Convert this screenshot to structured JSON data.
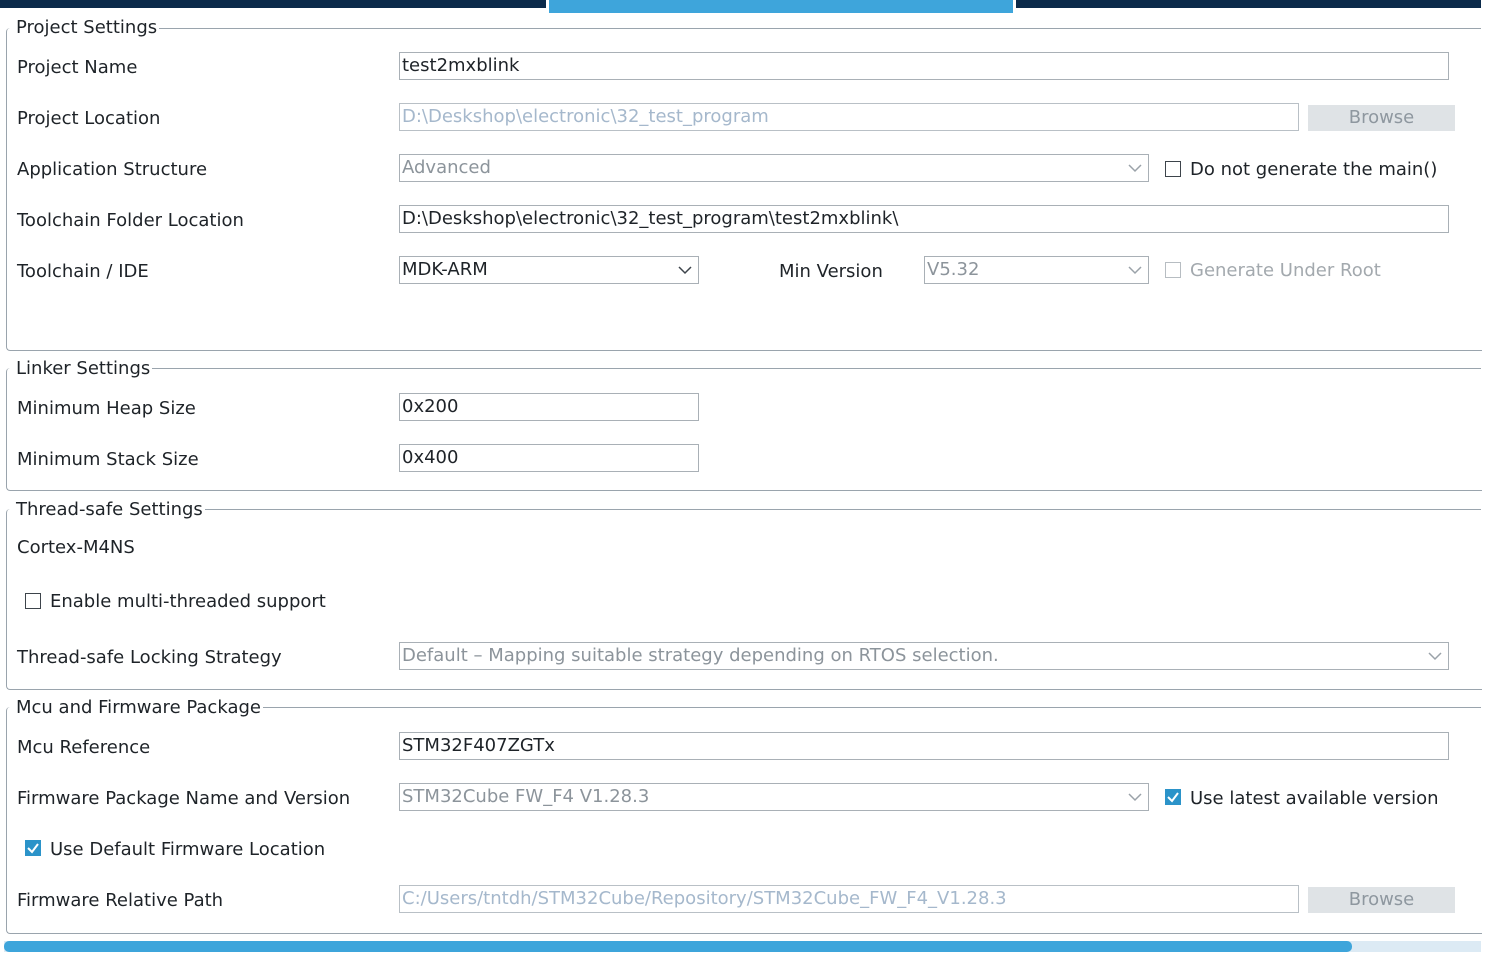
{
  "project_settings": {
    "title": "Project Settings",
    "project_name": {
      "label": "Project Name",
      "value": "test2mxblink"
    },
    "project_location": {
      "label": "Project Location",
      "value": "D:\\Deskshop\\electronic\\32_test_program",
      "button": "Browse"
    },
    "application_structure": {
      "label": "Application Structure",
      "value": "Advanced",
      "checkbox_label": "Do not generate the main()"
    },
    "toolchain_folder": {
      "label": "Toolchain Folder Location",
      "value": "D:\\Deskshop\\electronic\\32_test_program\\test2mxblink\\"
    },
    "toolchain_ide": {
      "label": "Toolchain / IDE",
      "value": "MDK-ARM",
      "min_version_label": "Min Version",
      "min_version_value": "V5.32",
      "generate_root_label": "Generate Under Root"
    }
  },
  "linker_settings": {
    "title": "Linker Settings",
    "heap": {
      "label": "Minimum Heap Size",
      "value": "0x200"
    },
    "stack": {
      "label": "Minimum Stack Size",
      "value": "0x400"
    }
  },
  "thread_safe": {
    "title": "Thread-safe Settings",
    "core": "Cortex-M4NS",
    "multithread_label": "Enable multi-threaded support",
    "strategy_label": "Thread-safe Locking Strategy",
    "strategy_value": "Default – Mapping suitable strategy depending on RTOS selection."
  },
  "mcu_firmware": {
    "title": "Mcu and Firmware Package",
    "mcu_ref": {
      "label": "Mcu Reference",
      "value": "STM32F407ZGTx"
    },
    "fw_package": {
      "label": "Firmware Package Name and Version",
      "value": "STM32Cube FW_F4 V1.28.3",
      "latest_label": "Use latest available version"
    },
    "default_location_label": "Use Default Firmware Location",
    "relative_path": {
      "label": "Firmware Relative Path",
      "value": "C:/Users/tntdh/STM32Cube/Repository/STM32Cube_FW_F4_V1.28.3",
      "button": "Browse"
    }
  },
  "colors": {
    "accent": "#3ea5db",
    "tab_dark": "#0b2a4a",
    "checkbox_checked": "#2b93c9"
  }
}
